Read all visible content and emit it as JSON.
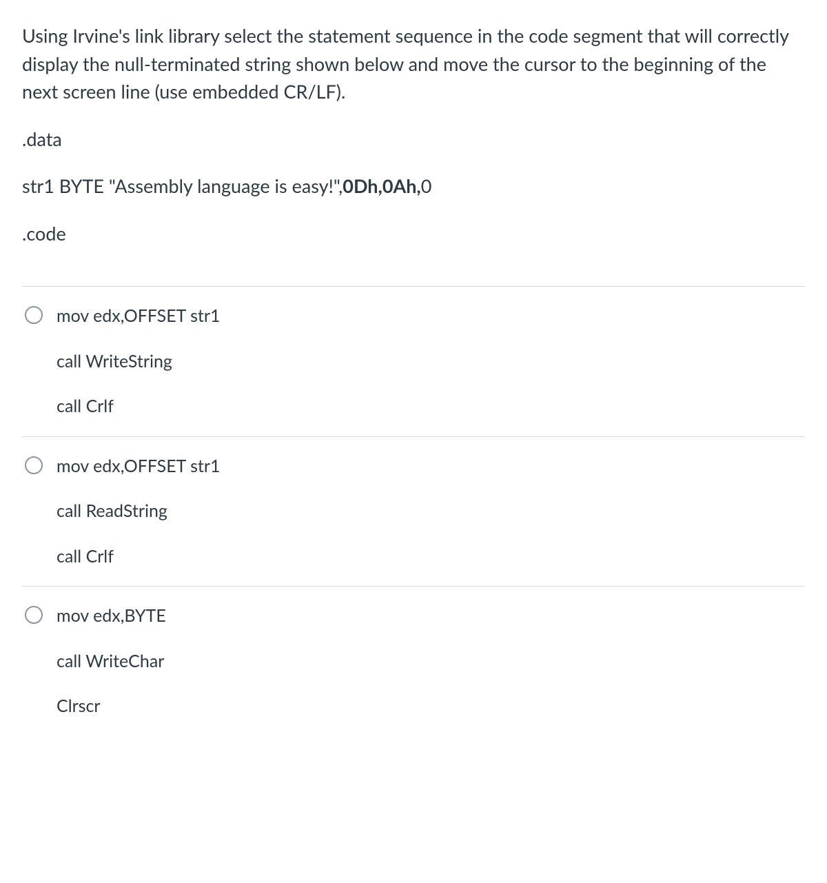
{
  "question": {
    "prompt": "Using Irvine's link library select the statement sequence in the code segment that will correctly display the null-terminated string shown below and move the cursor to the beginning of the next screen line (use embedded CR/LF).",
    "data_label": ".data",
    "str1_prefix": "str1 BYTE \"Assembly language is easy!\",",
    "str1_bold": "0Dh,0Ah,",
    "str1_suffix": "0",
    "code_label": ".code"
  },
  "options": [
    {
      "lines": [
        "mov edx,OFFSET str1",
        "call WriteString",
        "call Crlf"
      ]
    },
    {
      "lines": [
        "mov edx,OFFSET str1",
        "call ReadString",
        "call Crlf"
      ]
    },
    {
      "lines": [
        "mov edx,BYTE",
        "call WriteChar",
        "Clrscr"
      ]
    }
  ]
}
